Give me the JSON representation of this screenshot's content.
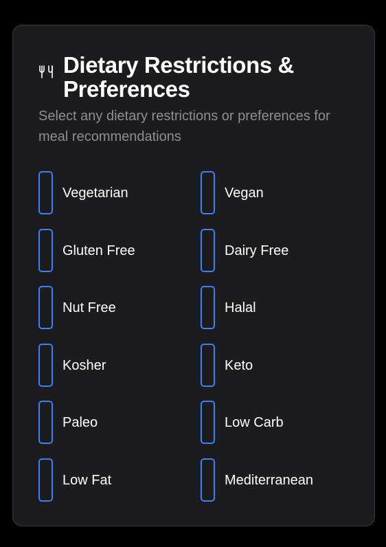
{
  "card": {
    "title": "Dietary Restrictions & Preferences",
    "subtitle": "Select any dietary restrictions or preferences for meal recommendations",
    "icon": "utensils-icon"
  },
  "options": [
    {
      "label": "Vegetarian",
      "checked": false
    },
    {
      "label": "Vegan",
      "checked": false
    },
    {
      "label": "Gluten Free",
      "checked": false
    },
    {
      "label": "Dairy Free",
      "checked": false
    },
    {
      "label": "Nut Free",
      "checked": false
    },
    {
      "label": "Halal",
      "checked": false
    },
    {
      "label": "Kosher",
      "checked": false
    },
    {
      "label": "Keto",
      "checked": false
    },
    {
      "label": "Paleo",
      "checked": false
    },
    {
      "label": "Low Carb",
      "checked": false
    },
    {
      "label": "Low Fat",
      "checked": false
    },
    {
      "label": "Mediterranean",
      "checked": false
    }
  ],
  "colors": {
    "background": "#000000",
    "card": "#1c1c1e",
    "card_border": "#3a3a3c",
    "accent": "#3b82f6",
    "muted_text": "#8e8e93"
  }
}
